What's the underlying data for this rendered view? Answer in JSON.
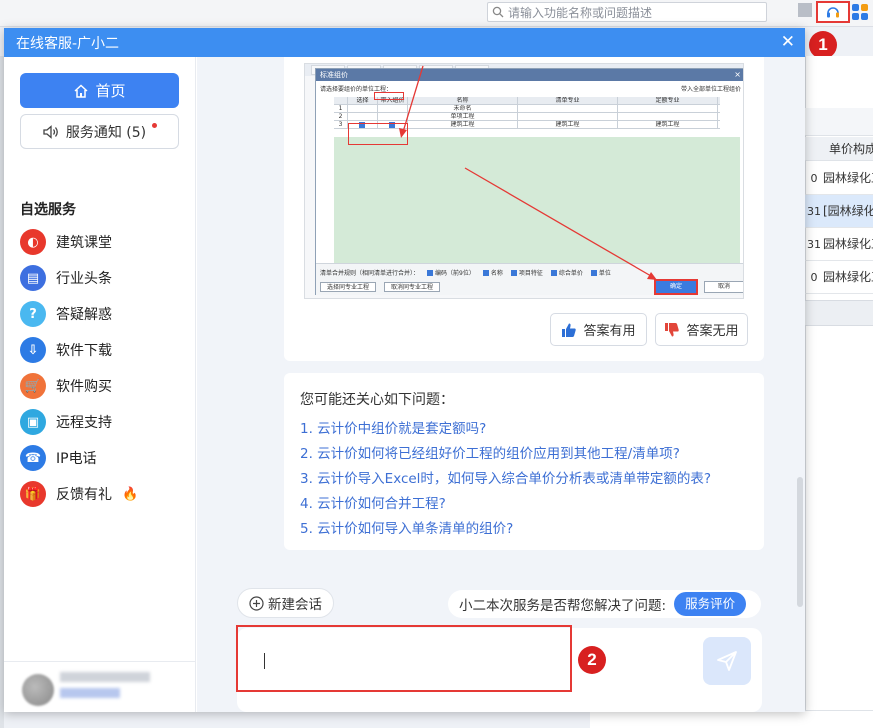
{
  "search": {
    "placeholder": "请输入功能名称或问题描述"
  },
  "annotations": {
    "badge1": "1",
    "badge2": "2"
  },
  "background_table": {
    "header": "单价构成",
    "rows": [
      {
        "num": "0",
        "text": "园林绿化工",
        "highlight": false
      },
      {
        "num": "31",
        "text": "[园林绿化",
        "highlight": true
      },
      {
        "num": "31",
        "text": "园林绿化工",
        "highlight": false
      },
      {
        "num": "0",
        "text": "园林绿化工",
        "highlight": false
      }
    ]
  },
  "dialog": {
    "title": "在线客服-广小二",
    "close_glyph": "✕"
  },
  "sidebar": {
    "home_label": "首页",
    "notice_label": "服务通知 (5)",
    "section_title": "自选服务",
    "items": [
      {
        "label": "建筑课堂",
        "icon": "academy-icon",
        "color": "#e8382c",
        "glyph": "◐"
      },
      {
        "label": "行业头条",
        "icon": "news-icon",
        "color": "#3d6fe0",
        "glyph": "▤"
      },
      {
        "label": "答疑解惑",
        "icon": "question-icon",
        "color": "#4ab8f0",
        "glyph": "?"
      },
      {
        "label": "软件下载",
        "icon": "download-icon",
        "color": "#2d7be5",
        "glyph": "⇩"
      },
      {
        "label": "软件购买",
        "icon": "cart-icon",
        "color": "#f0733a",
        "glyph": "🛒"
      },
      {
        "label": "远程支持",
        "icon": "remote-icon",
        "color": "#2fa8e0",
        "glyph": "▣"
      },
      {
        "label": "IP电话",
        "icon": "phone-icon",
        "color": "#2d7be5",
        "glyph": "☎"
      },
      {
        "label": "反馈有礼",
        "icon": "gift-icon",
        "color": "#e8382c",
        "glyph": "🎁"
      }
    ]
  },
  "screenshot_in_answer": {
    "dialog_title": "标准组价",
    "note": "请选择要组价的单位工程：",
    "apply_all": "带入全部单位工程组价",
    "columns": [
      "选择",
      "带入组价",
      "名称",
      "清单专业",
      "定额专业"
    ],
    "rows": [
      {
        "num": "1",
        "name": "未命名",
        "qd": "",
        "de": ""
      },
      {
        "num": "2",
        "name": "单项工程",
        "qd": "",
        "de": ""
      },
      {
        "num": "3",
        "name": "建筑工程",
        "qd": "建筑工程",
        "de": "建筑工程"
      }
    ],
    "options_label": "清单合并规则（相同清单进行合并）：",
    "options": [
      "编码（前9位）",
      "名称",
      "项目特征",
      "综合单价",
      "单位"
    ],
    "btn_select_same": "选择同专业工程",
    "btn_cancel_same": "取消同专业工程",
    "ok": "确定",
    "cancel": "取消"
  },
  "feedback": {
    "useful": "答案有用",
    "useless": "答案无用"
  },
  "related": {
    "heading": "您可能还关心如下问题：",
    "questions": [
      "1. 云计价中组价就是套定额吗?",
      "2. 云计价如何将已经组好价工程的组价应用到其他工程/清单项?",
      "3. 云计价导入Excel时，如何导入综合单价分析表或清单带定额的表?",
      "4. 云计价如何合并工程?",
      "5. 云计价如何导入单条清单的组价?"
    ]
  },
  "footer": {
    "new_chat": "新建会话",
    "eval_question": "小二本次服务是否帮您解决了问题:",
    "eval_button": "服务评价"
  },
  "colors": {
    "accent": "#3d82f2",
    "annotation_red": "#e53935"
  }
}
